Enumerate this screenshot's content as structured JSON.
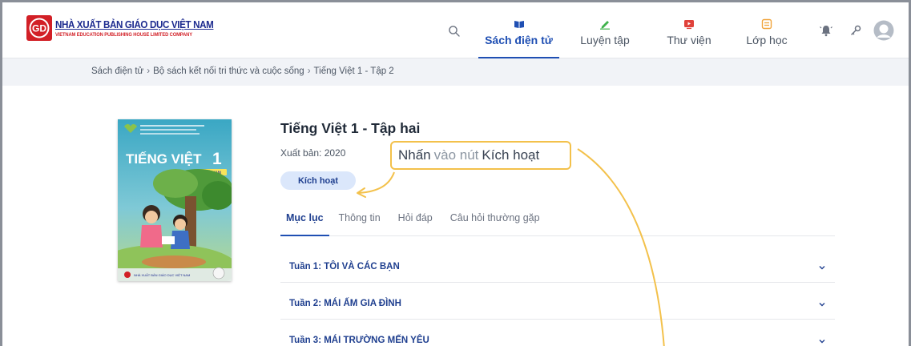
{
  "logo": {
    "mark": "GD",
    "title": "NHÀ XUẤT BẢN GIÁO DỤC VIỆT NAM",
    "subtitle": "VIETNAM EDUCATION PUBLISHING HOUSE LIMITED COMPANY",
    "brand_red": "#d21f26",
    "brand_blue": "#1d2b8f"
  },
  "header": {
    "search_icon": "search-icon",
    "nav": [
      {
        "label": "Sách điện tử",
        "icon": "book-open-icon",
        "active": true
      },
      {
        "label": "Luyện tập",
        "icon": "pencil-icon",
        "active": false
      },
      {
        "label": "Thư viện",
        "icon": "video-icon",
        "active": false
      },
      {
        "label": "Lớp học",
        "icon": "classroom-icon",
        "active": false
      }
    ],
    "right_icons": [
      "bell-icon",
      "key-icon",
      "user-avatar-icon"
    ],
    "accent": "#1f4fb3"
  },
  "breadcrumb": {
    "items": [
      "Sách điện tử",
      "Bộ sách kết nối tri thức và cuộc sống",
      "Tiếng Việt 1 - Tập 2"
    ],
    "separator": "›"
  },
  "cover": {
    "series_text": "BỘ SÁCH KẾT NỐI TRI THỨC VỚI CUỘC SỐNG",
    "title": "TIẾNG VIỆT",
    "number": "1",
    "volume": "TẬP HAI",
    "publisher": "NHÀ XUẤT BẢN GIÁO DỤC VIỆT NAM"
  },
  "book": {
    "title": "Tiếng Việt 1 - Tập hai",
    "published": "Xuất bản: 2020",
    "activate_label": "Kích hoạt"
  },
  "callout": {
    "part1": "Nhấn",
    "part2": "vào nút",
    "part3": "Kích hoạt",
    "color": "#f3c14b"
  },
  "tabs": [
    {
      "label": "Mục lục",
      "active": true
    },
    {
      "label": "Thông tin",
      "active": false
    },
    {
      "label": "Hỏi đáp",
      "active": false
    },
    {
      "label": "Câu hỏi thường gặp",
      "active": false
    }
  ],
  "weeks": [
    {
      "label": "Tuần 1: TÔI VÀ CÁC BẠN"
    },
    {
      "label": "Tuần 2: MÁI ẤM GIA ĐÌNH"
    },
    {
      "label": "Tuần 3: MÁI TRƯỜNG MẾN YÊU"
    }
  ]
}
